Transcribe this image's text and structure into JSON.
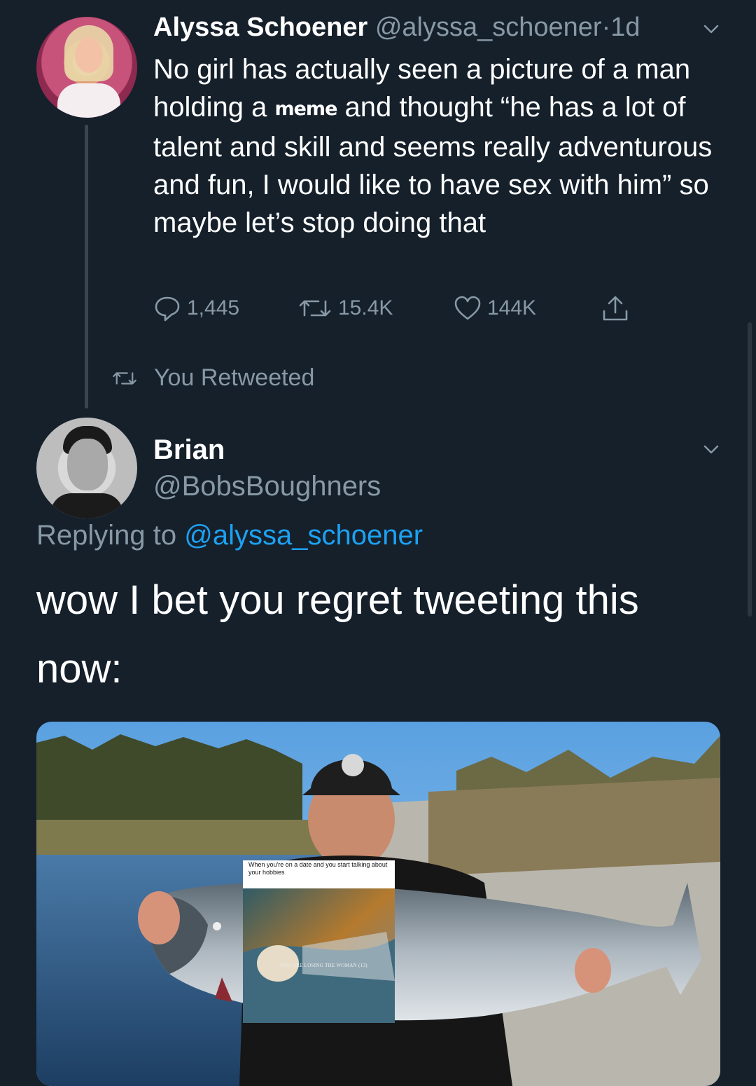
{
  "tweet1": {
    "author_name": "Alyssa Schoener",
    "handle": "@alyssa_schoener",
    "separator": "·",
    "time": "1d",
    "text_before": "No girl has actually seen a picture of a man holding a ",
    "meme_word": "meme",
    "text_after": " and thought “he has a lot of talent and skill and seems really adventurous and fun, I would like to have sex with him” so maybe let’s stop doing that",
    "reply_count": "1,445",
    "retweet_count": "15.4K",
    "like_count": "144K"
  },
  "retweet_status": "You Retweeted",
  "tweet2": {
    "author_name": "Brian",
    "handle": "@BobsBoughners",
    "replying_label": "Replying to ",
    "replying_handle": "@alyssa_schoener",
    "text": "wow I bet you regret tweeting this now:",
    "inset_caption": "When you're on a date and you start talking about your hobbies",
    "inset_overlay": "YOU ARE LOSING THE WOMAN (13)"
  },
  "colors": {
    "background": "#15202b",
    "muted": "#8899a6",
    "link": "#1da1f2"
  },
  "icons": [
    "avatar",
    "chevron-down-icon",
    "reply-icon",
    "retweet-icon",
    "heart-icon",
    "share-icon"
  ]
}
